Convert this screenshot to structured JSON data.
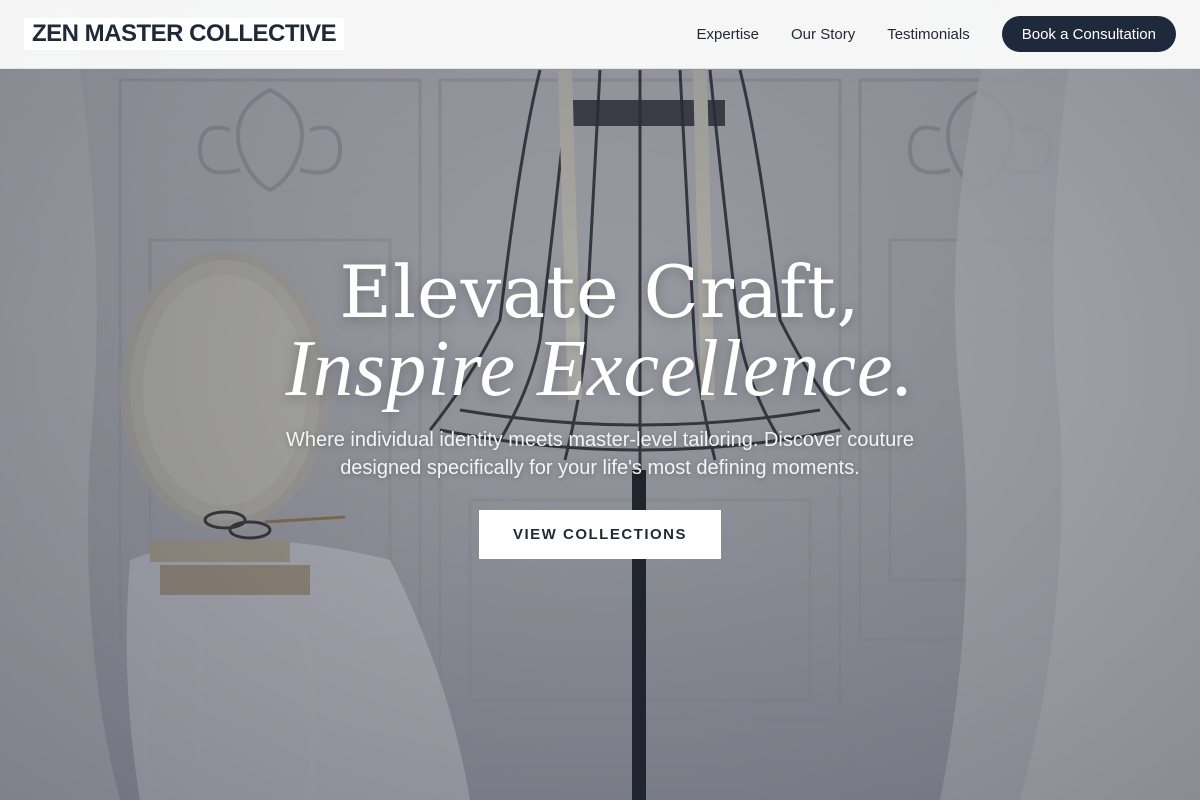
{
  "nav": {
    "brand": "ZEN MASTER COLLECTIVE",
    "links": [
      {
        "label": "Expertise"
      },
      {
        "label": "Our Story"
      },
      {
        "label": "Testimonials"
      }
    ],
    "cta_label": "Book a Consultation"
  },
  "hero": {
    "headline_line1": "Elevate Craft,",
    "headline_line2": "Inspire Excellence.",
    "subtitle": "Where individual identity meets master-level tailoring. Discover couture designed specifically for your life's most defining moments.",
    "button_label": "VIEW COLLECTIONS"
  },
  "colors": {
    "nav_background": "#fafafa",
    "accent_dark": "#1e293b",
    "text_dark": "#1f2937",
    "hero_text": "#ffffff"
  }
}
